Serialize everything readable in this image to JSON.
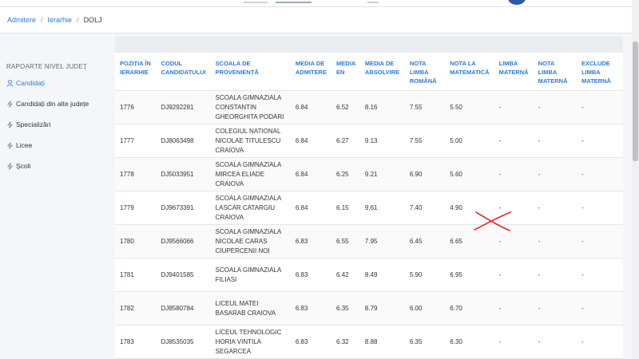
{
  "breadcrumb": {
    "items": [
      "Admitere",
      "Ierarhie"
    ],
    "current": "DOLJ"
  },
  "sidebar": {
    "section_title": "RAPOARTE NIVEL JUDEȚ",
    "items": [
      {
        "label": "Candidați",
        "icon": "user-icon",
        "active": true
      },
      {
        "label": "Candidați din alte județe",
        "icon": "bolt-icon",
        "active": false
      },
      {
        "label": "Specializări",
        "icon": "bolt-icon",
        "active": false
      },
      {
        "label": "Licee",
        "icon": "bolt-icon",
        "active": false
      },
      {
        "label": "Școli",
        "icon": "bolt-icon",
        "active": false
      }
    ]
  },
  "table": {
    "headers": [
      "POZIȚIA ÎN IERARHIE",
      "CODUL CANDIDATULUI",
      "ȘCOALA DE PROVENIENȚĂ",
      "MEDIA DE ADMITERE",
      "MEDIA EN",
      "MEDIA DE ABSOLVIRE",
      "NOTA LIMBA ROMÂNĂ",
      "NOTA LA MATEMATICĂ",
      "LIMBA MATERNĂ",
      "NOTA LIMBA MATERNĂ",
      "EXCLUDE LIMBA MATERNĂ"
    ],
    "rows": [
      [
        "1776",
        "DJ9292281",
        "SCOALA GIMNAZIALA CONSTANTIN GHEORGHITA PODARI",
        "6.84",
        "6.52",
        "8.16",
        "7.55",
        "5.50",
        "-",
        "-",
        "-"
      ],
      [
        "1777",
        "DJ8063498",
        "COLEGIUL NATIONAL NICOLAE TITULESCU CRAIOVA",
        "6.84",
        "6.27",
        "9.13",
        "7.55",
        "5.00",
        "-",
        "-",
        "-"
      ],
      [
        "1778",
        "DJ5033951",
        "SCOALA GIMNAZIALA MIRCEA ELIADE CRAIOVA",
        "6.84",
        "6.25",
        "9.21",
        "6.90",
        "5.60",
        "-",
        "-",
        "-"
      ],
      [
        "1779",
        "DJ9673391",
        "SCOALA GIMNAZIALA LASCAR CATARGIU CRAIOVA",
        "6.84",
        "6.15",
        "9.61",
        "7.40",
        "4.90",
        "-",
        "-",
        "-"
      ],
      [
        "1780",
        "DJ9566066",
        "SCOALA GIMNAZIALA NICOLAE CARAS CIUPERCENII NOI",
        "6.83",
        "6.55",
        "7.95",
        "6.45",
        "6.65",
        "-",
        "-",
        "-"
      ],
      [
        "1781",
        "DJ9401585",
        "SCOALA GIMNAZIALA FILIASI",
        "6.83",
        "6.42",
        "8.49",
        "5.90",
        "6.95",
        "-",
        "-",
        "-"
      ],
      [
        "1782",
        "DJ8580784",
        "LICEUL MATEI BASARAB CRAIOVA",
        "6.83",
        "6.35",
        "8.79",
        "6.00",
        "6.70",
        "-",
        "-",
        "-"
      ],
      [
        "1783",
        "DJ8535035",
        "LICEUL TEHNOLOGIC HORIA VINTILA SEGARCEA",
        "6.83",
        "6.32",
        "8.88",
        "6.35",
        "6.30",
        "-",
        "-",
        "-"
      ]
    ]
  },
  "colors": {
    "accent": "#2e7bd4",
    "annotation": "#e0242b"
  }
}
